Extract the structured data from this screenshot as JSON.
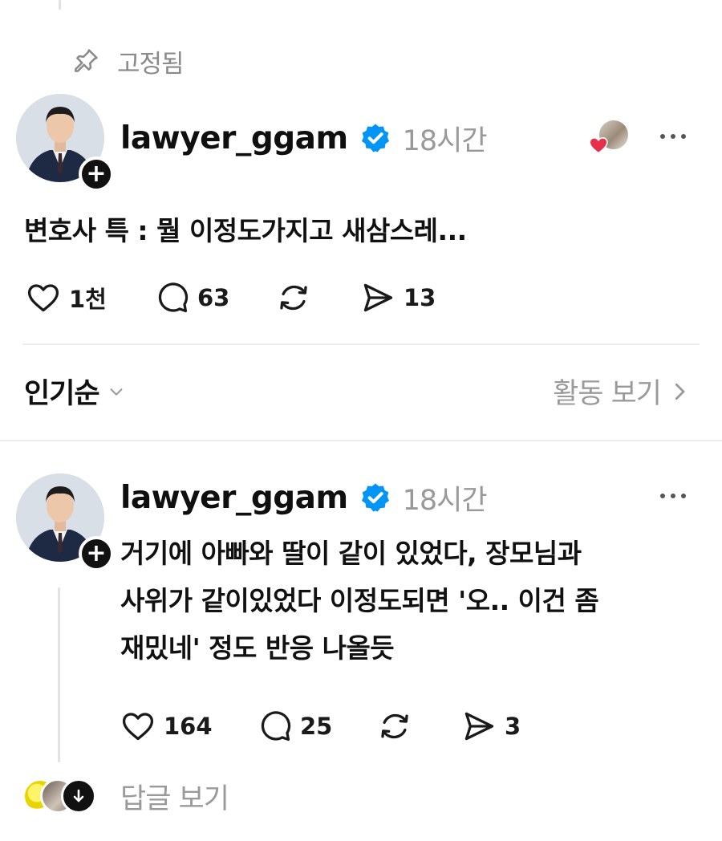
{
  "pinned_label": "고정됨",
  "post": {
    "username": "lawyer_ggam",
    "time": "18시간",
    "text": "변호사 특 : 뭘 이정도가지고 새삼스레...",
    "likes": "1천",
    "comments": "63",
    "shares": "13"
  },
  "sort": {
    "label": "인기순",
    "activity_label": "활동 보기"
  },
  "reply": {
    "username": "lawyer_ggam",
    "time": "18시간",
    "lines": [
      "거기에 아빠와 딸이 같이 있었다, 장모님과",
      "사위가 같이있었다 이정도되면 '오.. 이건 좀",
      "재밌네' 정도 반응 나올듯"
    ],
    "likes": "164",
    "comments": "25",
    "shares": "3"
  },
  "view_replies_label": "답글 보기",
  "colors": {
    "verified": "#0095f6",
    "like_heart": "#e8304a"
  }
}
